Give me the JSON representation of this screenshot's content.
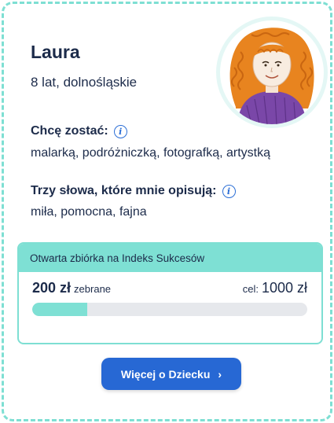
{
  "profile": {
    "name": "Laura",
    "age_region": "8 lat, dolnośląskie"
  },
  "want_to_be": {
    "title": "Chcę zostać:",
    "text": "malarką, podróżniczką, fotografką, artystką"
  },
  "three_words": {
    "title": "Trzy słowa, które mnie opisują:",
    "text": "miła, pomocna, fajna"
  },
  "fundraiser": {
    "header": "Otwarta zbiórka na Indeks Sukcesów",
    "raised_amount": "200 zł",
    "raised_label": "zebrane",
    "goal_label": "cel:",
    "goal_amount": "1000 zł",
    "progress": 0.2
  },
  "cta": {
    "label": "Więcej o Dziecku",
    "chevron": "›"
  },
  "colors": {
    "accent_teal": "#7ee0d4",
    "button_blue": "#2768d4",
    "text_navy": "#1c2b4a"
  },
  "icons": {
    "info": "info-icon",
    "chevron": "chevron-right-icon"
  }
}
